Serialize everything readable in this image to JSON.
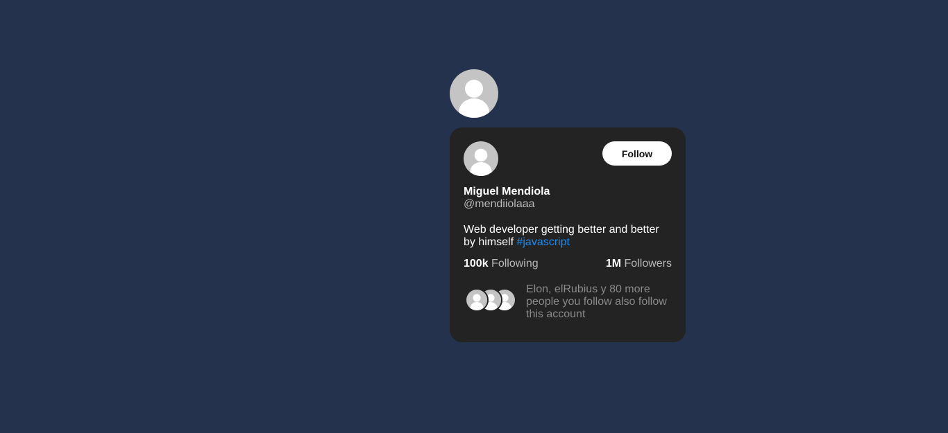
{
  "profile": {
    "name": "Miguel Mendiola",
    "handle": "@mendiiolaaa",
    "bio_text": "Web developer getting better and better by himself ",
    "bio_hashtag": "#javascript",
    "follow_label": "Follow"
  },
  "stats": {
    "following_count": "100k",
    "following_label": "Following",
    "followers_count": "1M",
    "followers_label": "Followers"
  },
  "mutual": {
    "text": "Elon, elRubius y 80 more people you follow also follow this account"
  },
  "icons": {
    "avatar": "default-user-avatar-icon"
  },
  "colors": {
    "background": "#25324d",
    "card": "#232323",
    "hashtag": "#1d8cf0",
    "avatar_bg": "#c4c4c4"
  }
}
